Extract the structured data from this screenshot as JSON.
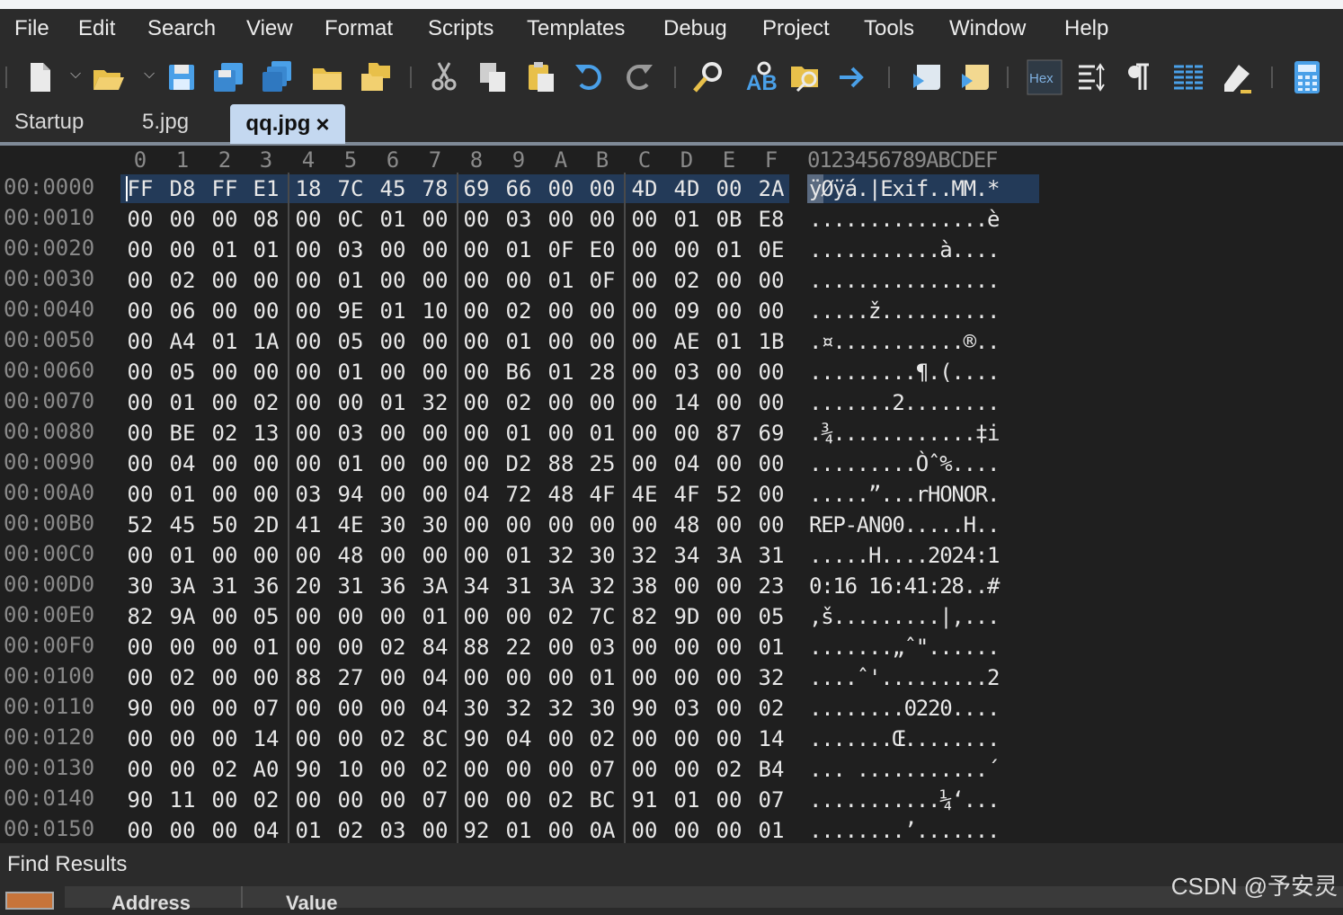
{
  "menu": [
    "File",
    "Edit",
    "Search",
    "View",
    "Format",
    "Scripts",
    "Templates",
    "Debug",
    "Project",
    "Tools",
    "Window",
    "Help"
  ],
  "toolbar": {
    "icons": [
      "new-file-icon",
      "open-folder-icon",
      "save-icon",
      "save-as-icon",
      "save-all-icon",
      "folder-icon",
      "open-workspace-icon",
      "cut-icon",
      "copy-icon",
      "paste-icon",
      "undo-icon",
      "redo-icon",
      "find-icon",
      "replace-icon",
      "find-in-files-icon",
      "goto-icon",
      "run-script-icon",
      "run-template-icon",
      "hex-mode-icon",
      "compare-icon",
      "pilcrow-icon",
      "columns-icon",
      "highlight-icon",
      "calculator-icon"
    ],
    "hex_label": "Hex"
  },
  "tabs": [
    {
      "label": "Startup"
    },
    {
      "label": "5.jpg"
    },
    {
      "label": "qq.jpg",
      "close": "×",
      "active": true
    }
  ],
  "hex": {
    "column_headers": [
      "0",
      "1",
      "2",
      "3",
      "4",
      "5",
      "6",
      "7",
      "8",
      "9",
      "A",
      "B",
      "C",
      "D",
      "E",
      "F"
    ],
    "ascii_header": "0123456789ABCDEF",
    "rows": [
      {
        "addr": "00:0000",
        "bytes": [
          "FF",
          "D8",
          "FF",
          "E1",
          "18",
          "7C",
          "45",
          "78",
          "69",
          "66",
          "00",
          "00",
          "4D",
          "4D",
          "00",
          "2A"
        ],
        "ascii": "ÿØÿá.|Exif..MM.*"
      },
      {
        "addr": "00:0010",
        "bytes": [
          "00",
          "00",
          "00",
          "08",
          "00",
          "0C",
          "01",
          "00",
          "00",
          "03",
          "00",
          "00",
          "00",
          "01",
          "0B",
          "E8"
        ],
        "ascii": "...............è"
      },
      {
        "addr": "00:0020",
        "bytes": [
          "00",
          "00",
          "01",
          "01",
          "00",
          "03",
          "00",
          "00",
          "00",
          "01",
          "0F",
          "E0",
          "00",
          "00",
          "01",
          "0E"
        ],
        "ascii": "...........à...."
      },
      {
        "addr": "00:0030",
        "bytes": [
          "00",
          "02",
          "00",
          "00",
          "00",
          "01",
          "00",
          "00",
          "00",
          "00",
          "01",
          "0F",
          "00",
          "02",
          "00",
          "00"
        ],
        "ascii": "................"
      },
      {
        "addr": "00:0040",
        "bytes": [
          "00",
          "06",
          "00",
          "00",
          "00",
          "9E",
          "01",
          "10",
          "00",
          "02",
          "00",
          "00",
          "00",
          "09",
          "00",
          "00"
        ],
        "ascii": ".....ž.........."
      },
      {
        "addr": "00:0050",
        "bytes": [
          "00",
          "A4",
          "01",
          "1A",
          "00",
          "05",
          "00",
          "00",
          "00",
          "01",
          "00",
          "00",
          "00",
          "AE",
          "01",
          "1B"
        ],
        "ascii": ".¤...........®.."
      },
      {
        "addr": "00:0060",
        "bytes": [
          "00",
          "05",
          "00",
          "00",
          "00",
          "01",
          "00",
          "00",
          "00",
          "B6",
          "01",
          "28",
          "00",
          "03",
          "00",
          "00"
        ],
        "ascii": ".........¶.(...."
      },
      {
        "addr": "00:0070",
        "bytes": [
          "00",
          "01",
          "00",
          "02",
          "00",
          "00",
          "01",
          "32",
          "00",
          "02",
          "00",
          "00",
          "00",
          "14",
          "00",
          "00"
        ],
        "ascii": ".......2........"
      },
      {
        "addr": "00:0080",
        "bytes": [
          "00",
          "BE",
          "02",
          "13",
          "00",
          "03",
          "00",
          "00",
          "00",
          "01",
          "00",
          "01",
          "00",
          "00",
          "87",
          "69"
        ],
        "ascii": ".¾............‡i"
      },
      {
        "addr": "00:0090",
        "bytes": [
          "00",
          "04",
          "00",
          "00",
          "00",
          "01",
          "00",
          "00",
          "00",
          "D2",
          "88",
          "25",
          "00",
          "04",
          "00",
          "00"
        ],
        "ascii": ".........Òˆ%...."
      },
      {
        "addr": "00:00A0",
        "bytes": [
          "00",
          "01",
          "00",
          "00",
          "03",
          "94",
          "00",
          "00",
          "04",
          "72",
          "48",
          "4F",
          "4E",
          "4F",
          "52",
          "00"
        ],
        "ascii": ".....”...rHONOR."
      },
      {
        "addr": "00:00B0",
        "bytes": [
          "52",
          "45",
          "50",
          "2D",
          "41",
          "4E",
          "30",
          "30",
          "00",
          "00",
          "00",
          "00",
          "00",
          "48",
          "00",
          "00"
        ],
        "ascii": "REP-AN00.....H.."
      },
      {
        "addr": "00:00C0",
        "bytes": [
          "00",
          "01",
          "00",
          "00",
          "00",
          "48",
          "00",
          "00",
          "00",
          "01",
          "32",
          "30",
          "32",
          "34",
          "3A",
          "31"
        ],
        "ascii": ".....H....2024:1"
      },
      {
        "addr": "00:00D0",
        "bytes": [
          "30",
          "3A",
          "31",
          "36",
          "20",
          "31",
          "36",
          "3A",
          "34",
          "31",
          "3A",
          "32",
          "38",
          "00",
          "00",
          "23"
        ],
        "ascii": "0:16 16:41:28..#"
      },
      {
        "addr": "00:00E0",
        "bytes": [
          "82",
          "9A",
          "00",
          "05",
          "00",
          "00",
          "00",
          "01",
          "00",
          "00",
          "02",
          "7C",
          "82",
          "9D",
          "00",
          "05"
        ],
        "ascii": ",š.........|,..."
      },
      {
        "addr": "00:00F0",
        "bytes": [
          "00",
          "00",
          "00",
          "01",
          "00",
          "00",
          "02",
          "84",
          "88",
          "22",
          "00",
          "03",
          "00",
          "00",
          "00",
          "01"
        ],
        "ascii": ".......„ˆ\"......"
      },
      {
        "addr": "00:0100",
        "bytes": [
          "00",
          "02",
          "00",
          "00",
          "88",
          "27",
          "00",
          "04",
          "00",
          "00",
          "00",
          "01",
          "00",
          "00",
          "00",
          "32"
        ],
        "ascii": "....ˆ'.........2"
      },
      {
        "addr": "00:0110",
        "bytes": [
          "90",
          "00",
          "00",
          "07",
          "00",
          "00",
          "00",
          "04",
          "30",
          "32",
          "32",
          "30",
          "90",
          "03",
          "00",
          "02"
        ],
        "ascii": "........0220...."
      },
      {
        "addr": "00:0120",
        "bytes": [
          "00",
          "00",
          "00",
          "14",
          "00",
          "00",
          "02",
          "8C",
          "90",
          "04",
          "00",
          "02",
          "00",
          "00",
          "00",
          "14"
        ],
        "ascii": ".......Œ........"
      },
      {
        "addr": "00:0130",
        "bytes": [
          "00",
          "00",
          "02",
          "A0",
          "90",
          "10",
          "00",
          "02",
          "00",
          "00",
          "00",
          "07",
          "00",
          "00",
          "02",
          "B4"
        ],
        "ascii": "... ...........´"
      },
      {
        "addr": "00:0140",
        "bytes": [
          "90",
          "11",
          "00",
          "02",
          "00",
          "00",
          "00",
          "07",
          "00",
          "00",
          "02",
          "BC",
          "91",
          "01",
          "00",
          "07"
        ],
        "ascii": "...........¼‘..."
      },
      {
        "addr": "00:0150",
        "bytes": [
          "00",
          "00",
          "00",
          "04",
          "01",
          "02",
          "03",
          "00",
          "92",
          "01",
          "00",
          "0A",
          "00",
          "00",
          "00",
          "01"
        ],
        "ascii": "........’......."
      }
    ]
  },
  "find_results": {
    "title": "Find Results",
    "columns": [
      "Address",
      "Value"
    ]
  },
  "watermark": "CSDN @予安灵"
}
